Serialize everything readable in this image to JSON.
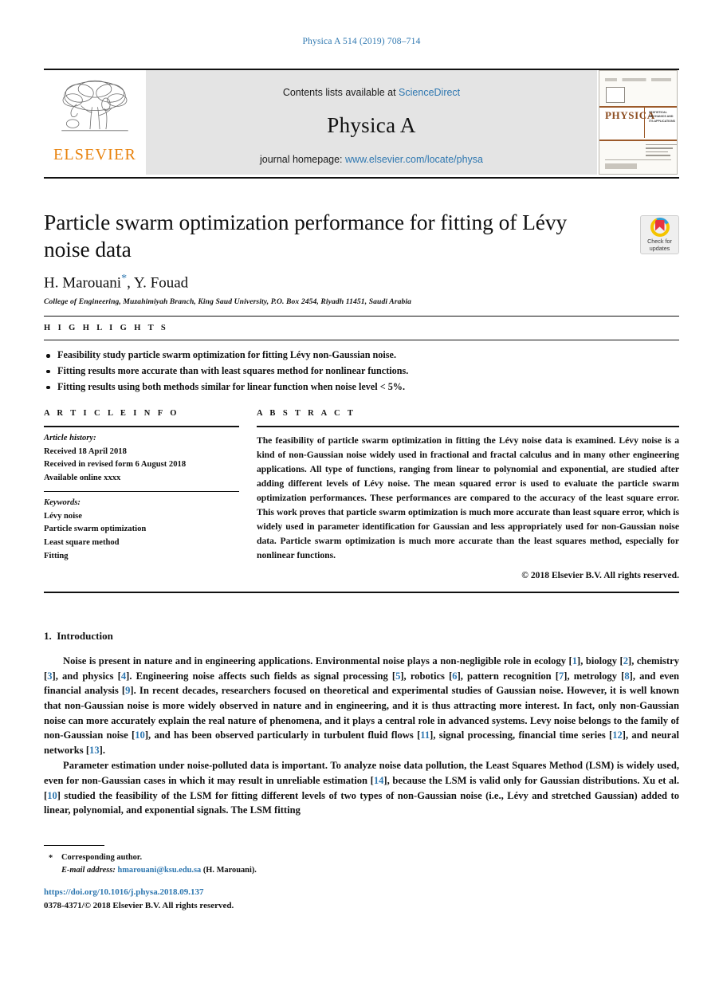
{
  "running_head": "Physica A 514 (2019) 708–714",
  "masthead": {
    "contents_prefix": "Contents lists available at ",
    "contents_link": "ScienceDirect",
    "journal_name": "Physica A",
    "homepage_prefix": "journal homepage: ",
    "homepage_link": "www.elsevier.com/locate/physa",
    "publisher_logo_text": "ELSEVIER",
    "cover": {
      "title": "PHYSICA",
      "subtitle": "STATISTICAL MECHANICS AND ITS APPLICATIONS"
    }
  },
  "article": {
    "title": "Particle swarm optimization performance for fitting of Lévy noise data",
    "authors": "H. Marouani",
    "author_marker": "*",
    "authors_rest": ", Y. Fouad",
    "affiliation": "College of Engineering, Muzahimiyah Branch, King Saud University, P.O. Box 2454, Riyadh 11451, Saudi Arabia",
    "crossmark_line1": "Check for",
    "crossmark_line2": "updates"
  },
  "highlights": {
    "label": "H I G H L I G H T S",
    "items": [
      "Feasibility study particle swarm optimization for fitting Lévy non-Gaussian noise.",
      "Fitting results more accurate than with least squares method for nonlinear functions.",
      "Fitting results using both methods similar for linear function when noise level < 5%."
    ]
  },
  "article_info": {
    "label": "A R T I C L E    I N F O",
    "history_label": "Article history:",
    "history": [
      "Received 18 April 2018",
      "Received in revised form 6 August 2018",
      "Available online  xxxx"
    ],
    "keywords_label": "Keywords:",
    "keywords": [
      "Lévy noise",
      "Particle swarm optimization",
      "Least square method",
      "Fitting"
    ]
  },
  "abstract": {
    "label": "A B S T R A C T",
    "text": "The feasibility of particle swarm optimization in fitting the Lévy noise data is examined. Lévy noise is a kind of non-Gaussian noise widely used in fractional and fractal calculus and in many other engineering applications. All type of functions, ranging from linear to polynomial and exponential, are studied after adding different levels of Lévy noise. The mean squared error is used to evaluate the particle swarm optimization performances. These performances are compared to the accuracy of the least square error. This work proves that particle swarm optimization is much more accurate than least square error, which is widely used in parameter identification for Gaussian and less appropriately used for non-Gaussian noise data. Particle swarm optimization is much more accurate than the least squares method, especially for nonlinear functions.",
    "copyright": "© 2018 Elsevier B.V. All rights reserved."
  },
  "body": {
    "section_number": "1.",
    "section_title": "Introduction",
    "paragraph1": {
      "p1": "Noise is present in nature and in engineering applications. Environmental noise plays a non-negligible role in ecology [",
      "c1": "1",
      "p2": "], biology [",
      "c2": "2",
      "p3": "], chemistry [",
      "c3": "3",
      "p4": "], and physics [",
      "c4": "4",
      "p5": "]. Engineering noise affects such fields as signal processing [",
      "c5": "5",
      "p6": "], robotics [",
      "c6": "6",
      "p7": "], pattern recognition [",
      "c7": "7",
      "p8": "], metrology [",
      "c8": "8",
      "p9": "], and even financial analysis [",
      "c9": "9",
      "p10": "]. In recent decades, researchers focused on theoretical and experimental studies of Gaussian noise. However, it is well known that non-Gaussian noise is more widely observed in nature and in engineering, and it is thus attracting more interest. In fact, only non-Gaussian noise can more accurately explain the real nature of phenomena, and it plays a central role in advanced systems. Levy noise belongs to the family of non-Gaussian noise [",
      "c10": "10",
      "p11": "], and has been observed particularly in turbulent fluid flows [",
      "c11": "11",
      "p12": "], signal processing, financial time series [",
      "c12": "12",
      "p13": "], and neural networks [",
      "c13": "13",
      "p14": "]."
    },
    "paragraph2": {
      "p1": "Parameter estimation under noise-polluted data is important. To analyze noise data pollution, the Least Squares Method (LSM) is widely used, even for non-Gaussian cases in which it may result in unreliable estimation [",
      "c1": "14",
      "p2": "], because the LSM is valid only for Gaussian distributions. Xu et al. [",
      "c2": "10",
      "p3": "] studied the feasibility of the LSM for fitting different levels of two types of non-Gaussian noise (i.e., Lévy and stretched Gaussian) added to linear, polynomial, and exponential signals. The LSM fitting"
    }
  },
  "footer": {
    "corresponding": "Corresponding author.",
    "email_label": "E-mail address:",
    "email": "hmarouani@ksu.edu.sa",
    "email_suffix": "(H. Marouani).",
    "doi": "https://doi.org/10.1016/j.physa.2018.09.137",
    "issn": "0378-4371/© 2018 Elsevier B.V. All rights reserved."
  },
  "colors": {
    "link_blue": "#2e77b0",
    "elsevier_orange": "#e8820c",
    "cover_brown": "#9c5a2a"
  }
}
